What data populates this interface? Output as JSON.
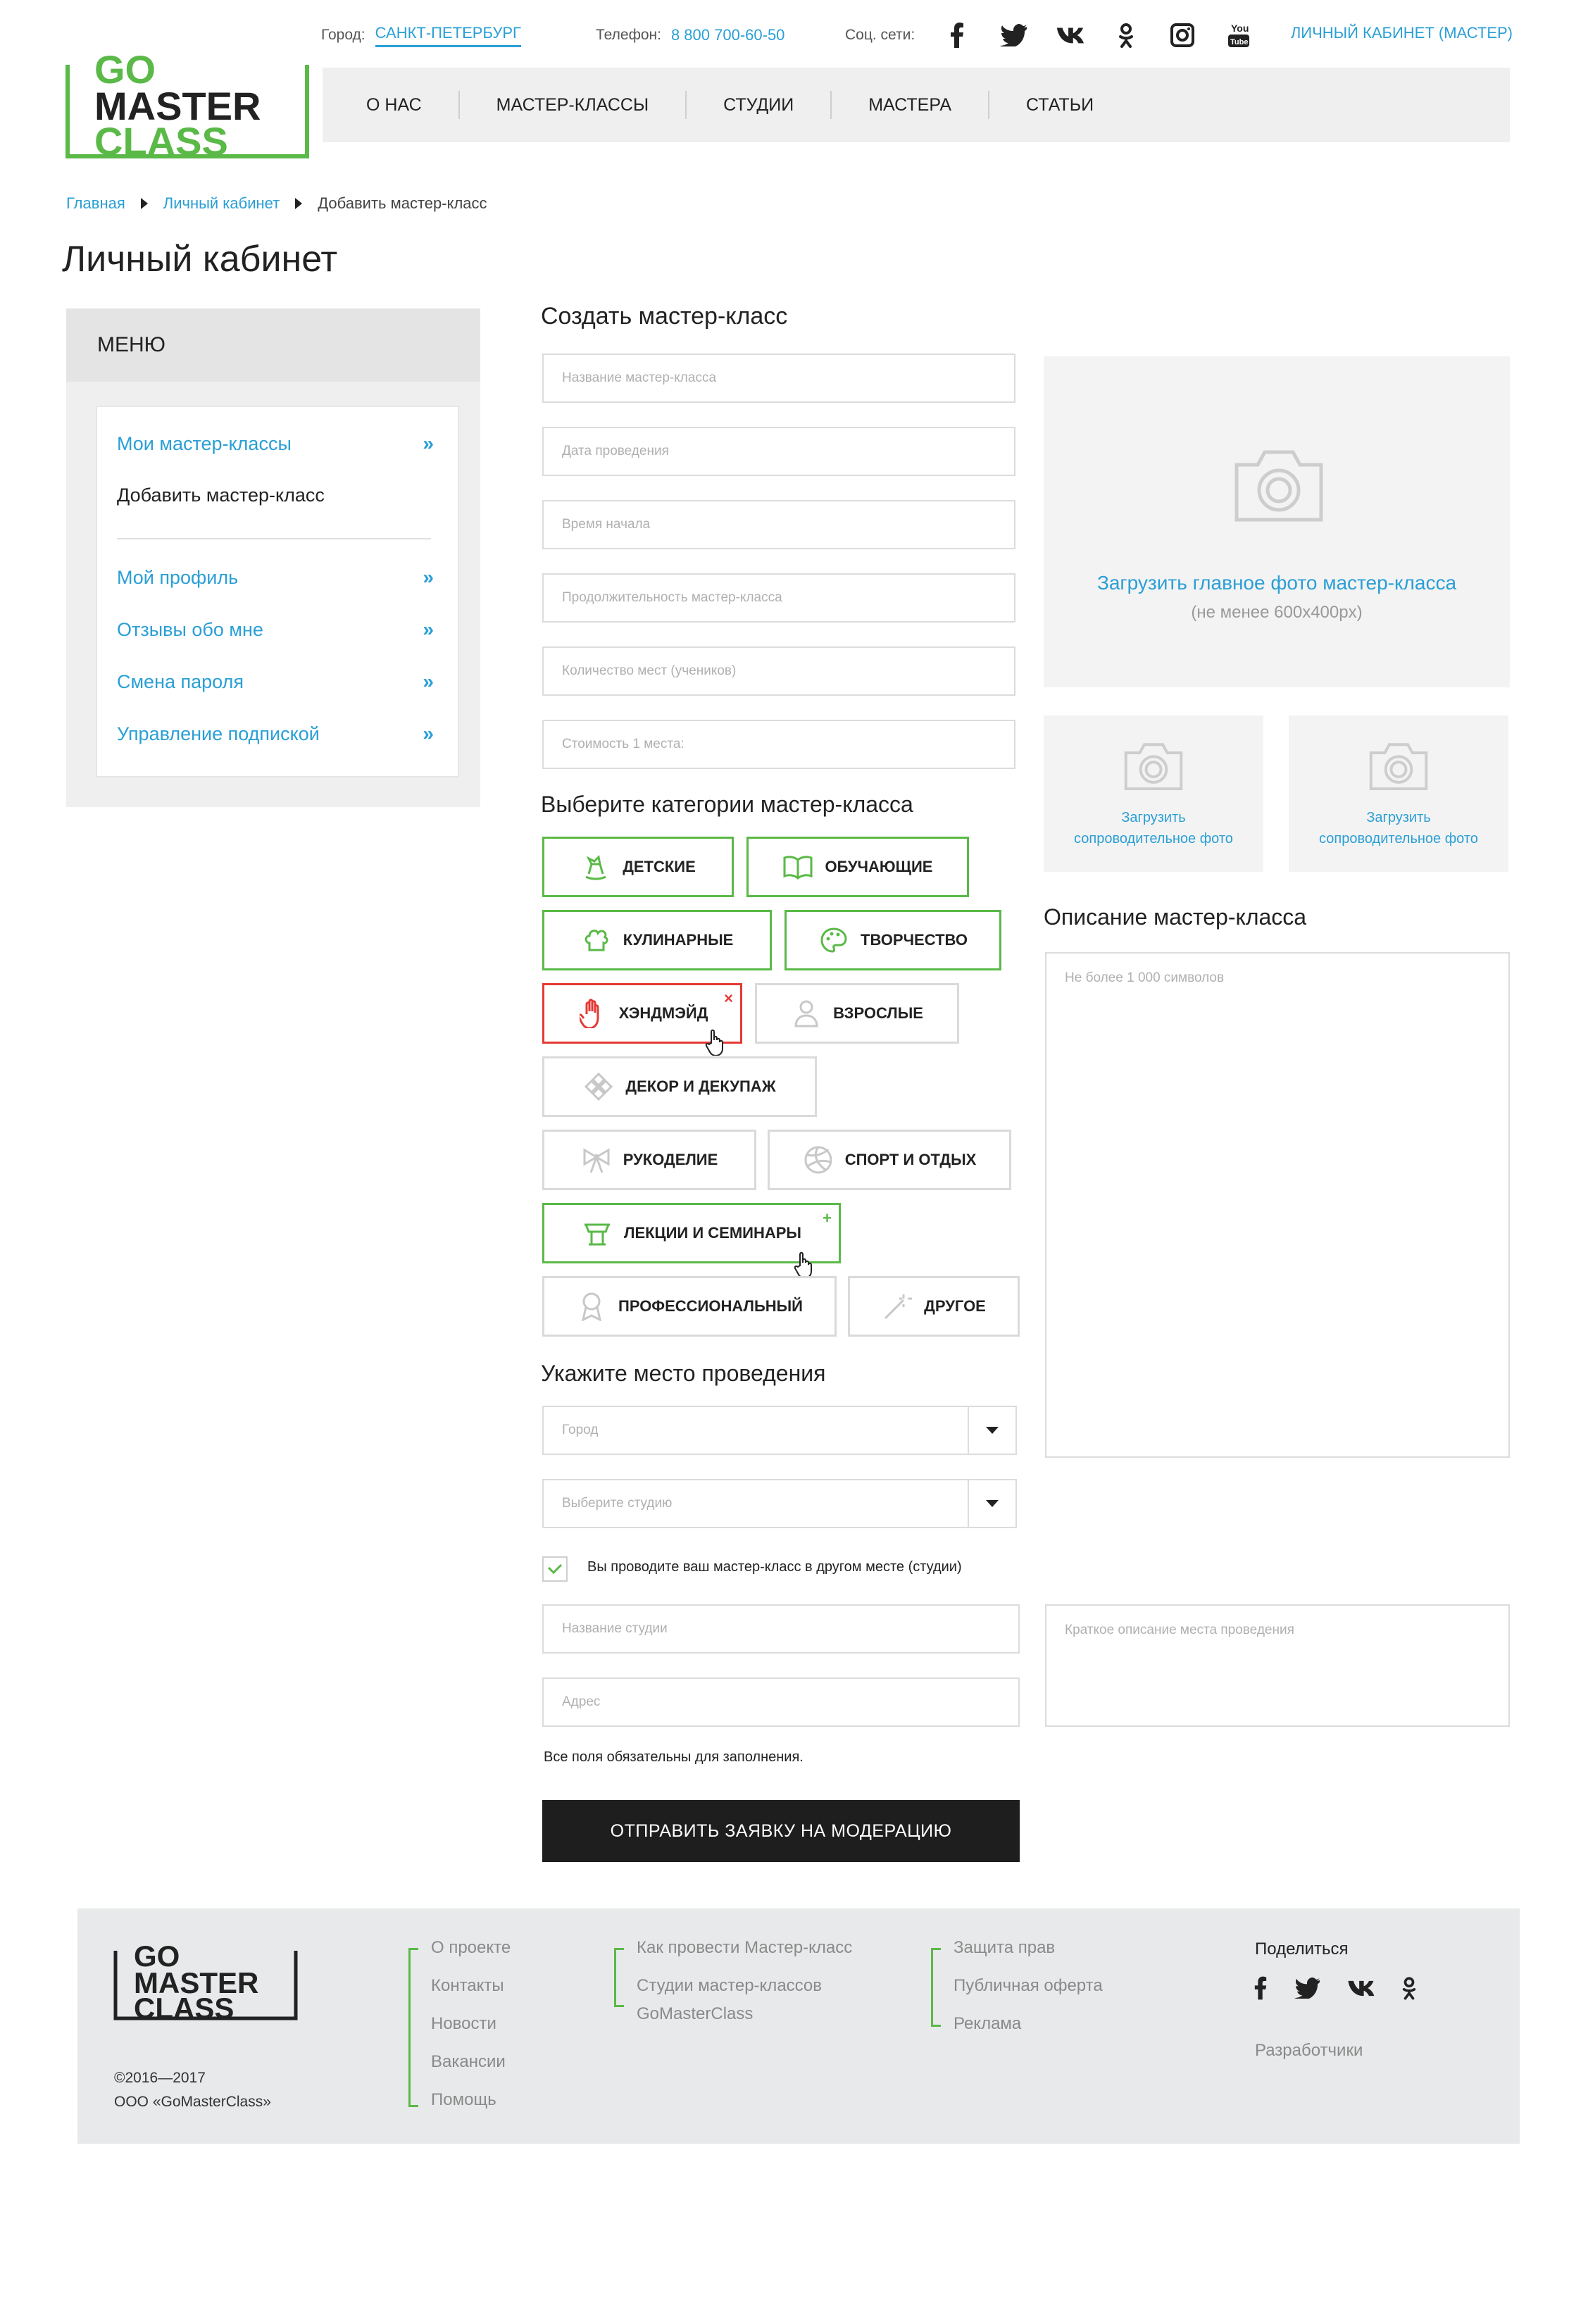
{
  "header": {
    "logo_text": [
      "GO",
      "MASTER",
      "CLASS"
    ],
    "city_label": "Город:",
    "city_value": "САНКТ-ПЕТЕРБУРГ",
    "phone_label": "Телефон:",
    "phone_value": "8 800 700-60-50",
    "social_label": "Соц. сети:",
    "social_icons": [
      "facebook-icon",
      "twitter-icon",
      "vk-icon",
      "odnoklassniki-icon",
      "instagram-icon",
      "youtube-icon"
    ],
    "cabinet_link": "ЛИЧНЫЙ КАБИНЕТ (МАСТЕР)",
    "nav": [
      "О НАС",
      "МАСТЕР-КЛАССЫ",
      "СТУДИИ",
      "МАСТЕРА",
      "СТАТЬИ"
    ]
  },
  "breadcrumb": [
    "Главная",
    "Личный кабинет",
    "Добавить мастер-класс"
  ],
  "page_title": "Личный кабинет",
  "sidebar": {
    "title": "МЕНЮ",
    "items": [
      {
        "label": "Мои мастер-классы",
        "active": false
      },
      {
        "label": "Добавить мастер-класс",
        "active": true
      },
      {
        "label": "Мой профиль",
        "active": false
      },
      {
        "label": "Отзывы обо мне",
        "active": false
      },
      {
        "label": "Смена пароля",
        "active": false
      },
      {
        "label": "Управление подпиской",
        "active": false
      }
    ]
  },
  "form": {
    "title": "Создать мастер-класс",
    "fields": [
      "Название мастер-класса",
      "Дата проведения",
      "Время начала",
      "Продолжительность мастер-класса",
      "Количество мест (учеников)",
      "Стоимость 1 места:"
    ],
    "categories_title": "Выберите категории мастер-класса",
    "categories": [
      {
        "label": "ДЕТСКИЕ",
        "state": "selected"
      },
      {
        "label": "ОБУЧАЮЩИЕ",
        "state": "selected"
      },
      {
        "label": "КУЛИНАРНЫЕ",
        "state": "selected"
      },
      {
        "label": "ТВОРЧЕСТВО",
        "state": "selected"
      },
      {
        "label": "ХЭНДМЭЙД",
        "state": "remove-hover"
      },
      {
        "label": "ВЗРОСЛЫЕ",
        "state": "default"
      },
      {
        "label": "ДЕКОР И ДЕКУПАЖ",
        "state": "default"
      },
      {
        "label": "РУКОДЕЛИЕ",
        "state": "default"
      },
      {
        "label": "СПОРТ И ОТДЫХ",
        "state": "default"
      },
      {
        "label": "ЛЕКЦИИ И СЕМИНАРЫ",
        "state": "add-hover"
      },
      {
        "label": "ПРОФЕССИОНАЛЬНЫЙ",
        "state": "default"
      },
      {
        "label": "ДРУГОЕ",
        "state": "default"
      }
    ],
    "remove_mark": "×",
    "add_mark": "+",
    "place_title": "Укажите место проведения",
    "city_select": "Город",
    "studio_select": "Выберите студию",
    "other_place_checkbox": "Вы проводите ваш мастер-класс в другом месте (студии)",
    "studio_name": "Название студии",
    "address": "Адрес",
    "required_note": "Все поля обязательны для заполнения.",
    "submit": "ОТПРАВИТЬ ЗАЯВКУ НА МОДЕРАЦИЮ"
  },
  "photos": {
    "main_upload": "Загрузить главное фото мастер-класса",
    "main_hint": "(не менее 600х400px)",
    "extra_upload_1": "Загрузить",
    "extra_upload_2": "сопроводительное фото"
  },
  "description": {
    "title": "Описание мастер-класса",
    "placeholder": "Не более 1 000 символов",
    "place_placeholder": "Краткое описание места проведения"
  },
  "footer": {
    "copyright_years": "©2016—2017",
    "company": "ООО «GoMasterClass»",
    "col1": [
      "О проекте",
      "Контакты",
      "Новости",
      "Вакансии",
      "Помощь"
    ],
    "col2": [
      "Как провести Мастер-класс",
      "Студии мастер-классов",
      "GoMasterClass"
    ],
    "col3": [
      "Защита прав",
      "Публичная оферта",
      "Реклама"
    ],
    "share_title": "Поделиться",
    "developers": "Разработчики"
  },
  "colors": {
    "accent_blue": "#2a9fd6",
    "accent_green": "#5ab947",
    "accent_red": "#e53935",
    "dark_button": "#1e1e1e"
  }
}
